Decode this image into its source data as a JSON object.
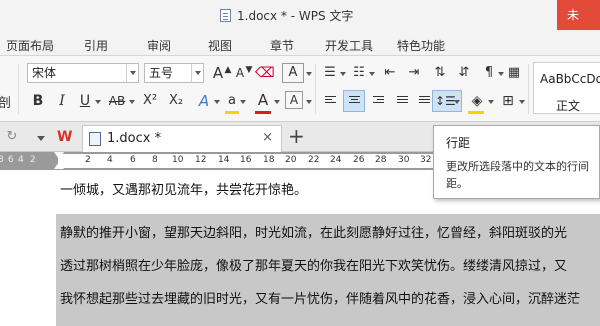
{
  "window": {
    "title": "1.docx * - WPS 文字",
    "login_label": "未"
  },
  "menu": {
    "items": [
      "页面布局",
      "引用",
      "审阅",
      "视图",
      "章节",
      "开发工具",
      "特色功能"
    ]
  },
  "ribbon": {
    "font_name": "宋体",
    "font_size": "五号",
    "grow_font_label": "A",
    "shrink_font_label": "A",
    "clear_format_label": "A",
    "bold_label": "B",
    "italic_label": "I",
    "underline_label": "U",
    "strike_label": "AB",
    "superscript_label": "X²",
    "subscript_label": "X₂",
    "text_effect_label": "A",
    "highlight_label": "a",
    "font_color_label": "A",
    "char_border_label": "A",
    "left_partial_label": "剖",
    "style_sample": "AaBbCcDd",
    "style_name": "正文",
    "colors": {
      "highlight": "#f2d600",
      "font_color": "#d41f1f",
      "active_align": "#cfe3f7"
    }
  },
  "tabs": {
    "active_tab_label": "1.docx *",
    "close_label": "×",
    "add_label": "+"
  },
  "ruler": {
    "numbers": [
      "8",
      "6",
      "4",
      "2",
      "2",
      "4",
      "6",
      "8",
      "10",
      "12",
      "14",
      "16",
      "18",
      "20",
      "22",
      "24",
      "26",
      "28",
      "30",
      "32",
      "34",
      "36",
      "38"
    ]
  },
  "document": {
    "lines": [
      "一倾城，又遇那初见流年，共尝花开惊艳。",
      "静默的推开小窗，望那天边斜阳，时光如流，在此刻愿静好过往，忆曾经，斜阳斑驳的光",
      "透过那树梢照在少年脸庞，像极了那年夏天的你我在阳光下欢笑忧伤。缕缕清风掠过，又",
      "我怀想起那些过去埋藏的旧时光，又有一片忧伤，伴随着风中的花香，浸入心间，沉醉迷茫"
    ]
  },
  "tooltip": {
    "title": "行距",
    "body": "更改所选段落中的文本的行间距。"
  }
}
